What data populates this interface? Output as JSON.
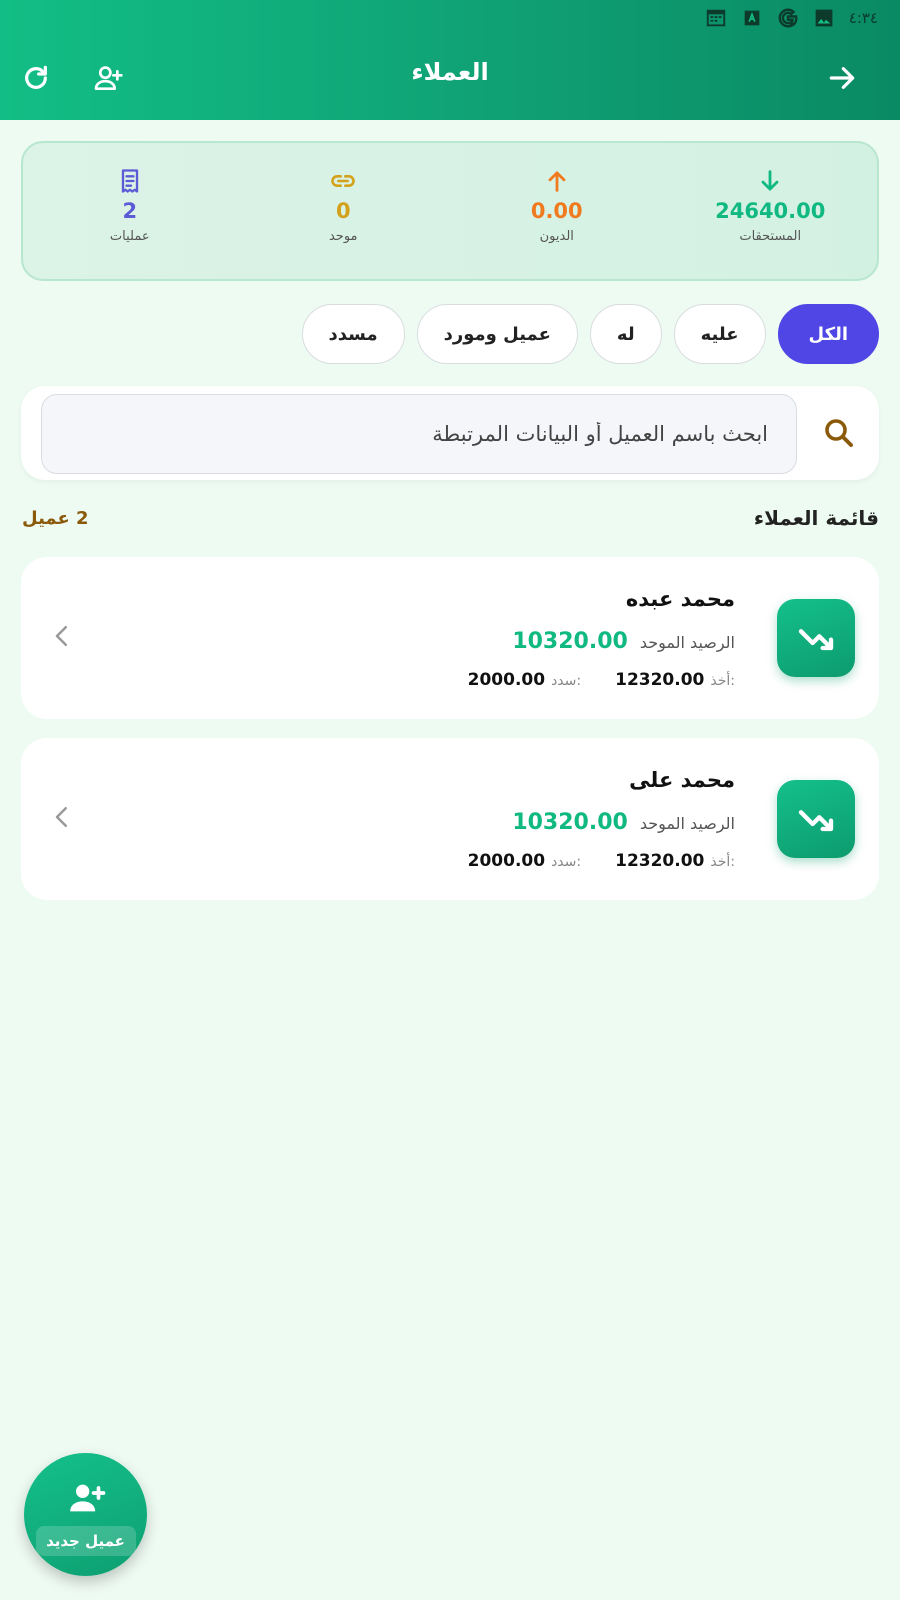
{
  "status_bar": {
    "time": "٤:٣٤"
  },
  "header": {
    "title": "العملاء"
  },
  "summary": [
    {
      "value": "24640.00",
      "label": "المستحقات",
      "icon": "arrow-down-icon",
      "color": "#10b981"
    },
    {
      "value": "0.00",
      "label": "الديون",
      "icon": "arrow-up-icon",
      "color": "#f07a1e"
    },
    {
      "value": "0",
      "label": "موحد",
      "icon": "link-icon",
      "color": "#d4a21a"
    },
    {
      "value": "2",
      "label": "عمليات",
      "icon": "receipt-icon",
      "color": "#5b5bd6"
    }
  ],
  "filters": [
    "الكل",
    "عليه",
    "له",
    "عميل ومورد",
    "مسدد"
  ],
  "search": {
    "placeholder": "ابحث باسم العميل أو البيانات المرتبطة"
  },
  "list": {
    "title": "قائمة العملاء",
    "count": "2 عميل",
    "customers": [
      {
        "name": "محمد عبده",
        "balance_label": "الرصيد الموحد",
        "balance": "10320.00",
        "took_label": "أخذ:",
        "took": "12320.00",
        "paid_label": "سدد:",
        "paid": "2000.00"
      },
      {
        "name": "محمد على",
        "balance_label": "الرصيد الموحد",
        "balance": "10320.00",
        "took_label": "أخذ:",
        "took": "12320.00",
        "paid_label": "سدد:",
        "paid": "2000.00"
      }
    ]
  },
  "fab": {
    "label": "عميل جديد"
  },
  "colors": {
    "primary": "#12be85",
    "accent": "#4f46e5",
    "background": "#eefbf3"
  }
}
